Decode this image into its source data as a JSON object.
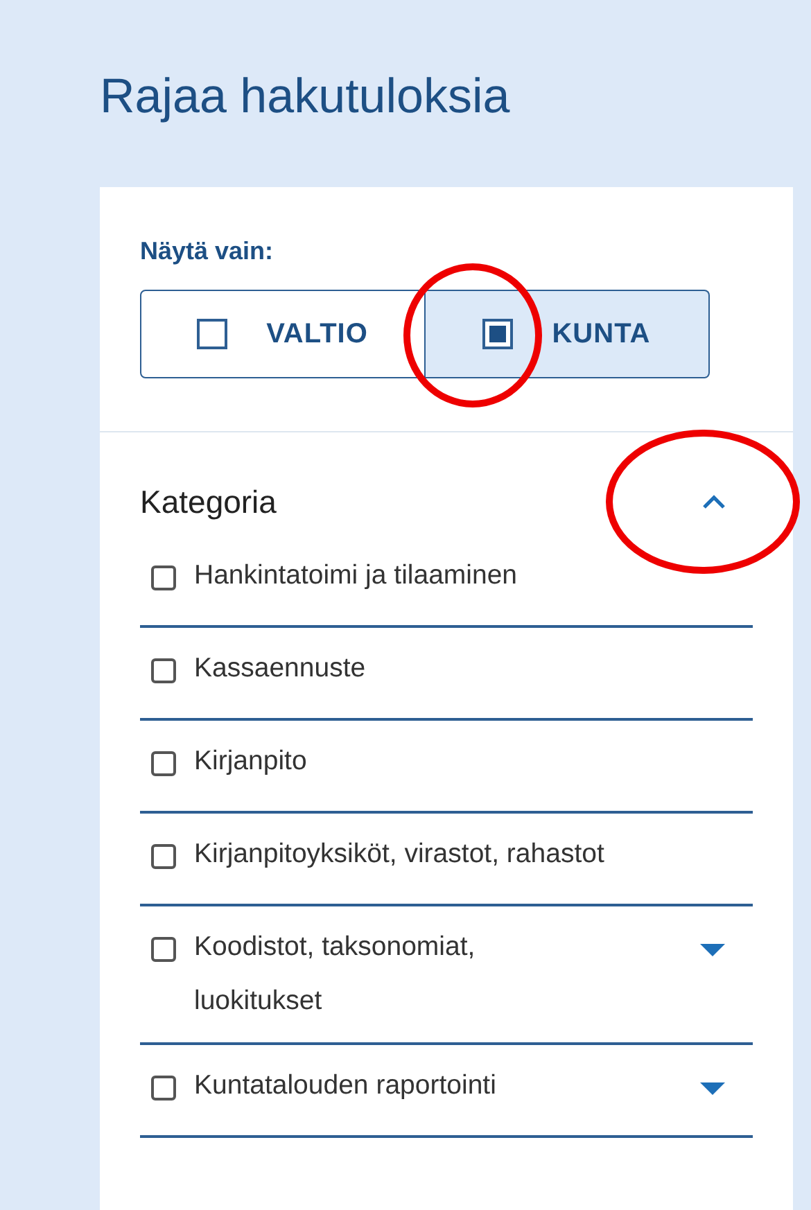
{
  "title": "Rajaa hakutuloksia",
  "show_only": {
    "label": "Näytä vain:",
    "options": [
      {
        "label": "VALTIO",
        "selected": false,
        "circled": false
      },
      {
        "label": "KUNTA",
        "selected": true,
        "circled": true
      }
    ]
  },
  "category": {
    "heading": "Kategoria",
    "expanded": true,
    "toggle_circled": true,
    "items": [
      {
        "label": "Hankintatoimi ja tilaaminen",
        "checked": false,
        "has_children": false
      },
      {
        "label": "Kassaennuste",
        "checked": false,
        "has_children": false
      },
      {
        "label": "Kirjanpito",
        "checked": false,
        "has_children": false
      },
      {
        "label": "Kirjanpitoyksiköt, virastot, rahastot",
        "checked": false,
        "has_children": false
      },
      {
        "label": "Koodistot, taksonomiat, luokitukset",
        "checked": false,
        "has_children": true
      },
      {
        "label": "Kuntatalouden raportointi",
        "checked": false,
        "has_children": true
      }
    ]
  }
}
